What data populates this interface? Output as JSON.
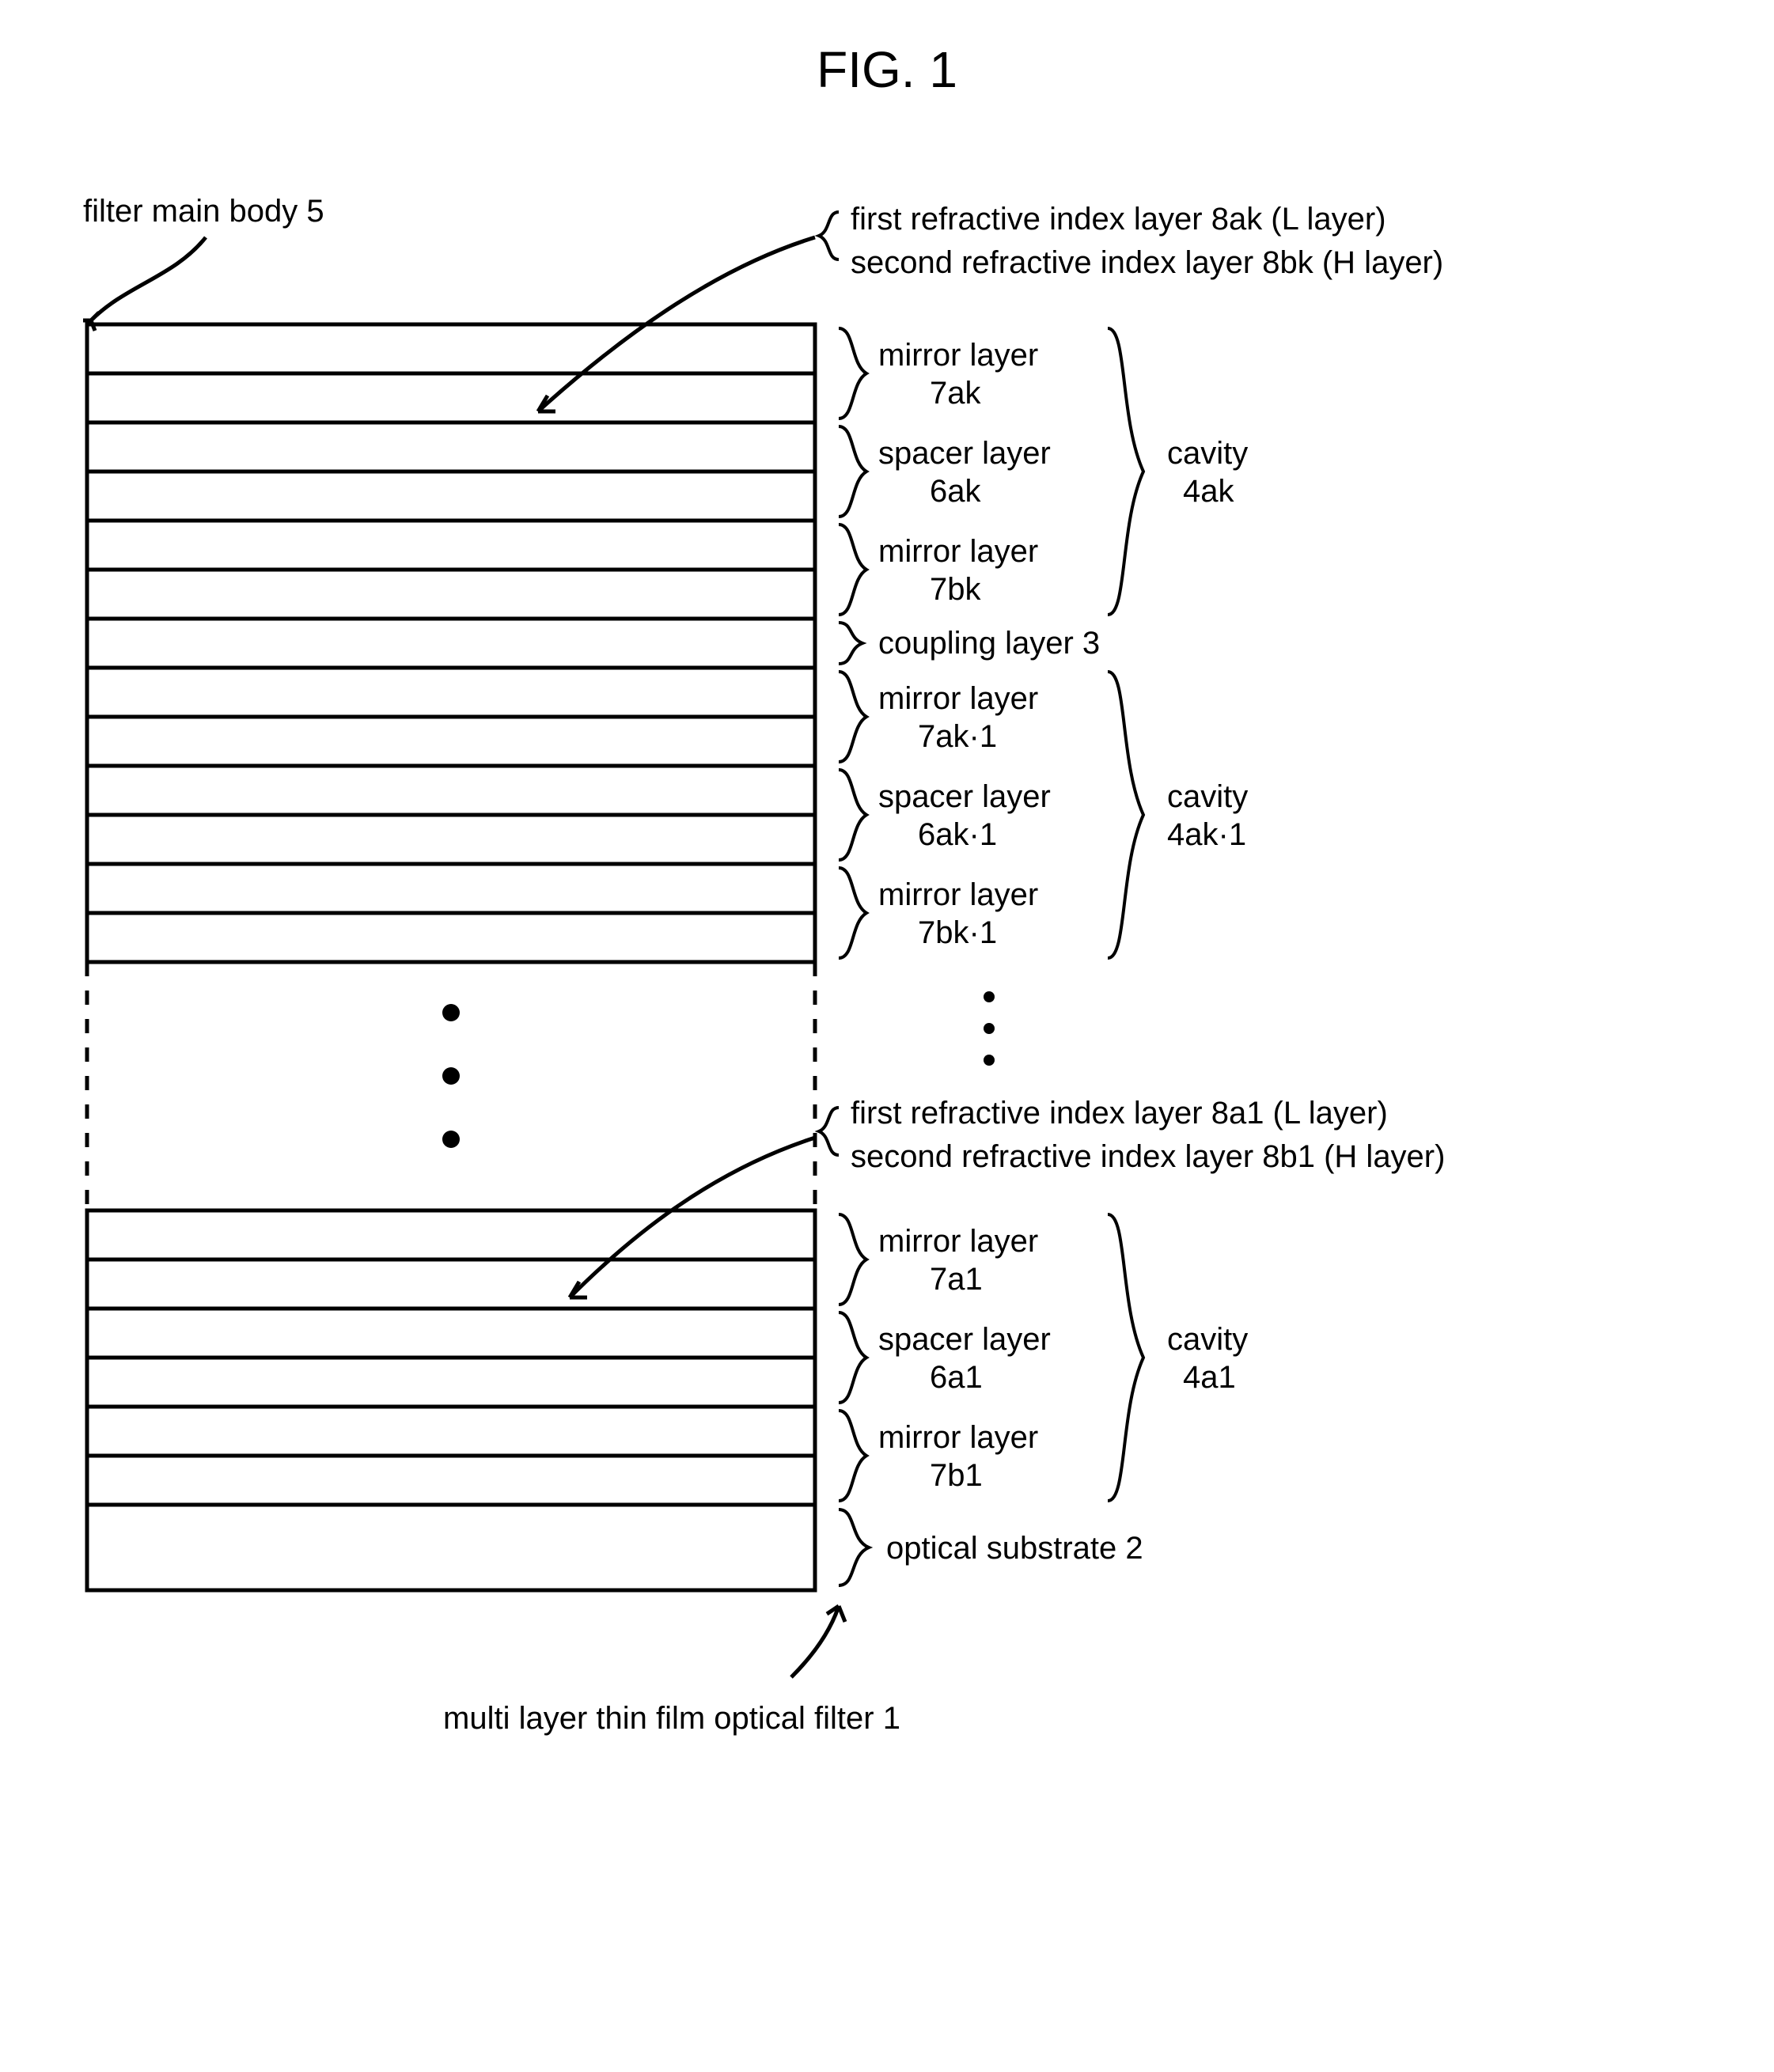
{
  "title": "FIG. 1",
  "top_ptr": "filter main body 5",
  "legend_top_1": "first refractive index layer 8ak (L layer)",
  "legend_top_2": "second refractive index layer 8bk (H layer)",
  "c1_mirror_top": "mirror layer",
  "c1_mirror_top_id": "7ak",
  "c1_spacer": "spacer layer",
  "c1_spacer_id": "6ak",
  "c1_mirror_bot": "mirror layer",
  "c1_mirror_bot_id": "7bk",
  "c1_cavity": "cavity",
  "c1_cavity_id": "4ak",
  "coupling": "coupling layer 3",
  "c2_mirror_top": "mirror layer",
  "c2_mirror_top_id": "7ak·1",
  "c2_spacer": "spacer layer",
  "c2_spacer_id": "6ak·1",
  "c2_mirror_bot": "mirror layer",
  "c2_mirror_bot_id": "7bk·1",
  "c2_cavity": "cavity",
  "c2_cavity_id": "4ak·1",
  "legend_bot_1": "first refractive index layer 8a1 (L layer)",
  "legend_bot_2": "second refractive index layer 8b1 (H layer)",
  "c3_mirror_top": "mirror layer",
  "c3_mirror_top_id": "7a1",
  "c3_spacer": "spacer layer",
  "c3_spacer_id": "6a1",
  "c3_mirror_bot": "mirror layer",
  "c3_mirror_bot_id": "7b1",
  "c3_cavity": "cavity",
  "c3_cavity_id": "4a1",
  "substrate": "optical substrate 2",
  "bottom_ptr": "multi layer thin film optical filter 1"
}
